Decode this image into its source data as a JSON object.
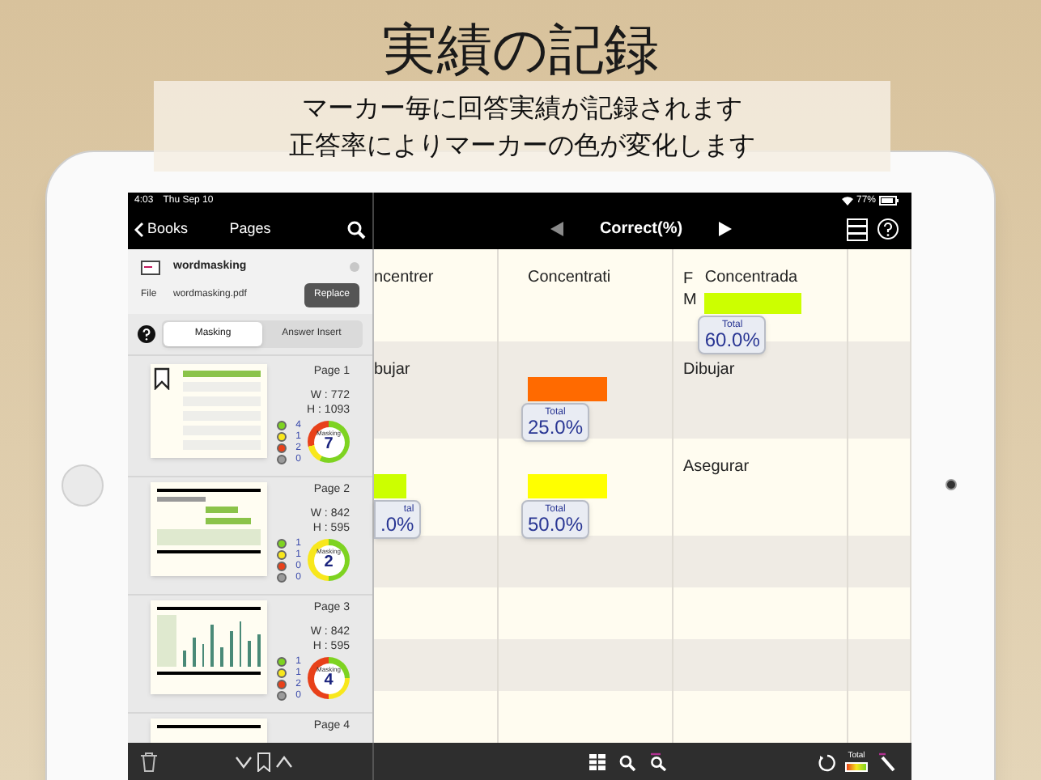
{
  "headline": "実績の記録",
  "caption": [
    "マーカー毎に回答実績が記録されます",
    "正答率によりマーカーの色が変化します"
  ],
  "status_bar": {
    "time": "4:03",
    "date": "Thu Sep 10",
    "battery": "77%"
  },
  "sidebar": {
    "back": "Books",
    "title": "Pages",
    "file": {
      "name": "wordmasking",
      "label": "File",
      "filename": "wordmasking.pdf",
      "button": "Replace"
    },
    "tabs": [
      {
        "label": "Masking",
        "selected": true
      },
      {
        "label": "Answer Insert",
        "selected": false
      }
    ],
    "pages": [
      {
        "title": "Page 1",
        "width": "W : 772",
        "height": "H : 1093",
        "counts": [
          "4",
          "1",
          "2",
          "0"
        ],
        "ring_label": "Masking",
        "total": "7",
        "bookmarked": true,
        "kind": "portrait"
      },
      {
        "title": "Page 2",
        "width": "W : 842",
        "height": "H : 595",
        "counts": [
          "1",
          "1",
          "0",
          "0"
        ],
        "ring_label": "Masking",
        "total": "2",
        "bookmarked": false,
        "kind": "bars"
      },
      {
        "title": "Page 3",
        "width": "W : 842",
        "height": "H : 595",
        "counts": [
          "1",
          "1",
          "2",
          "0"
        ],
        "ring_label": "Masking",
        "total": "4",
        "bookmarked": false,
        "kind": "chart"
      },
      {
        "title": "Page 4"
      }
    ]
  },
  "header": {
    "title": "Correct(%)"
  },
  "table": {
    "rows": [
      {
        "cells": [
          {
            "text": "ncentrer"
          },
          {
            "text": "Concentrati"
          },
          {
            "marks": [
              "F",
              "M"
            ],
            "text": "Concentrada",
            "marker": {
              "color": "#ccff00",
              "label": "Total",
              "value": "60.0%"
            }
          }
        ]
      },
      {
        "cells": [
          {
            "text": "bujar"
          },
          {
            "marker": {
              "color": "#ff6a00",
              "label": "Total",
              "value": "25.0%"
            }
          },
          {
            "text": "Dibujar"
          }
        ]
      },
      {
        "cells": [
          {
            "marker": {
              "color": "#ccff00",
              "label": "tal",
              "value": ".0%",
              "clipped": true
            }
          },
          {
            "marker": {
              "color": "#ffff00",
              "label": "Total",
              "value": "50.0%"
            }
          },
          {
            "text": "Asegurar"
          }
        ]
      }
    ]
  },
  "toolbar": {
    "total_label": "Total"
  }
}
